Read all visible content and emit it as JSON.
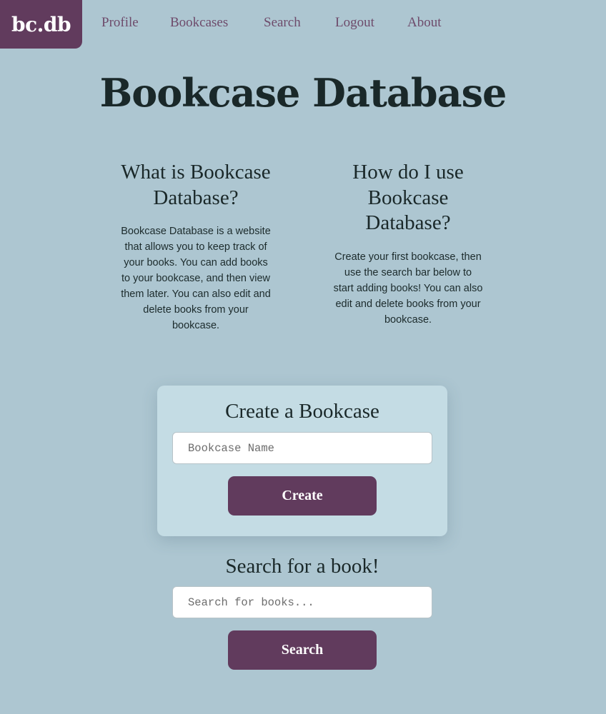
{
  "nav": {
    "logo": "bc.db",
    "links": [
      "Profile",
      "Bookcases",
      "Search",
      "Logout",
      "About"
    ]
  },
  "page": {
    "title": "Bookcase Database"
  },
  "info": {
    "what": {
      "heading": "What is Bookcase Database?",
      "text": "Bookcase Database is a website that allows you to keep track of your books. You can add books to your bookcase, and then view them later. You can also edit and delete books from your bookcase."
    },
    "how": {
      "heading": "How do I use Bookcase Database?",
      "text": "Create your first bookcase, then use the search bar below to start adding books! You can also edit and delete books from your bookcase."
    }
  },
  "create": {
    "heading": "Create a Bookcase",
    "placeholder": "Bookcase Name",
    "value": "",
    "button": "Create"
  },
  "search": {
    "heading": "Search for a book!",
    "placeholder": "Search for books...",
    "value": "",
    "button": "Search"
  },
  "colors": {
    "background": "#adc6d1",
    "accent": "#613b5d",
    "card": "#c4dce4",
    "nav_link": "#6e4b6b",
    "heading_text": "#1a2829"
  }
}
